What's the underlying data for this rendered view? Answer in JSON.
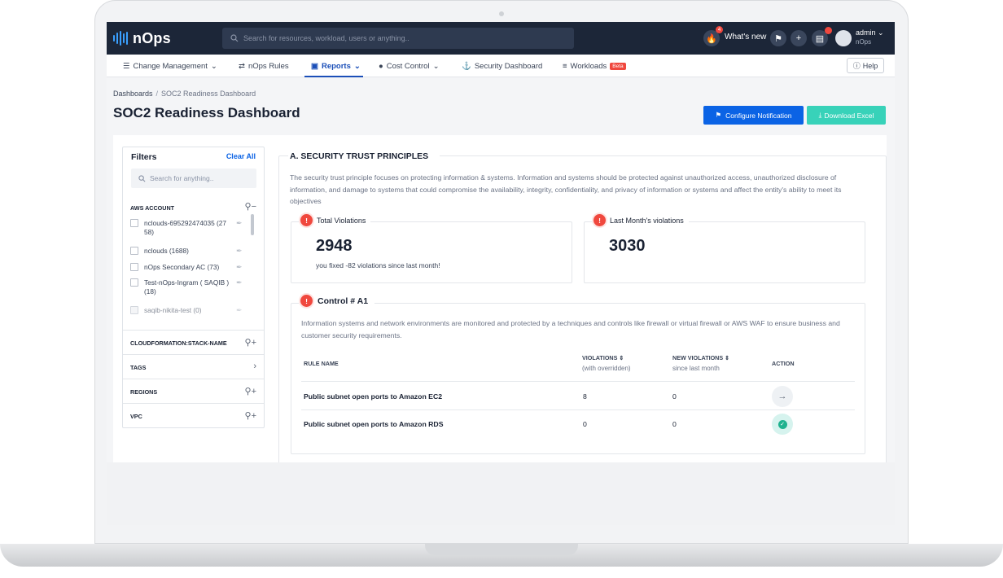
{
  "topbar": {
    "logo": "nOps",
    "search_placeholder": "Search for resources, workload, users or anything..",
    "notification_count": "4",
    "whats_new": "What's new",
    "user": {
      "name": "admin",
      "org": "nOps"
    }
  },
  "subnav": {
    "items": [
      {
        "label": "Change Management",
        "icon": "list-icon",
        "dropdown": true
      },
      {
        "label": "nOps Rules",
        "icon": "swap-icon",
        "dropdown": false
      },
      {
        "label": "Reports",
        "icon": "report-icon",
        "dropdown": true,
        "active": true
      },
      {
        "label": "Cost Control",
        "icon": "dollar-icon",
        "dropdown": true
      },
      {
        "label": "Security Dashboard",
        "icon": "lock-icon",
        "dropdown": false
      },
      {
        "label": "Workloads",
        "icon": "layers-icon",
        "dropdown": false,
        "badge": "Beta"
      }
    ],
    "help": "Help"
  },
  "page": {
    "breadcrumb": {
      "root": "Dashboards",
      "current": "SOC2 Readiness Dashboard"
    },
    "title": "SOC2 Readiness Dashboard",
    "configure_notification": "Configure Notification",
    "download_excel": "Download Excel"
  },
  "filters": {
    "title": "Filters",
    "clear_all": "Clear All",
    "search_placeholder": "Search for anything..",
    "aws_account": {
      "label": "AWS ACCOUNT",
      "accounts": [
        "nclouds-695292474035 (27 58)",
        "nclouds (1688)",
        "nOps Secondary AC (73)",
        "Test-nOps-Ingram ( SAQIB ) (18)",
        "saqib-nikita-test (0)"
      ]
    },
    "sections": [
      "CLOUDFORMATION:STACK-NAME",
      "TAGS",
      "REGIONS",
      "VPC"
    ]
  },
  "trust": {
    "title": "A. SECURITY TRUST PRINCIPLES",
    "description": "The security trust principle focuses on protecting information & systems. Information and systems should be protected against unauthorized access, unauthorized disclosure of information, and damage to systems that could compromise the availability, integrity, confidentiality, and privacy of information or systems and affect the entity's ability to meet its objectives",
    "total_violations": {
      "label": "Total Violations",
      "value": "2948",
      "note": "you fixed -82 violations since last month!"
    },
    "last_month": {
      "label": "Last Month's violations",
      "value": "3030"
    }
  },
  "control": {
    "title": "Control # A1",
    "description": "Information systems and network environments are monitored and protected by a techniques and controls like firewall or virtual firewall or AWS WAF to ensure business and customer security requirements.",
    "columns": {
      "rule": "RULE NAME",
      "violations": "VIOLATIONS ⇕",
      "violations_sub": "(with overridden)",
      "new_violations": "NEW VIOLATIONS ⇕",
      "new_violations_sub": "since last month",
      "action": "ACTION"
    },
    "rows": [
      {
        "rule": "Public subnet open ports to Amazon EC2",
        "violations": "8",
        "new": "0",
        "action": "arrow"
      },
      {
        "rule": "Public subnet open ports to Amazon RDS",
        "violations": "0",
        "new": "0",
        "action": "check"
      }
    ]
  }
}
